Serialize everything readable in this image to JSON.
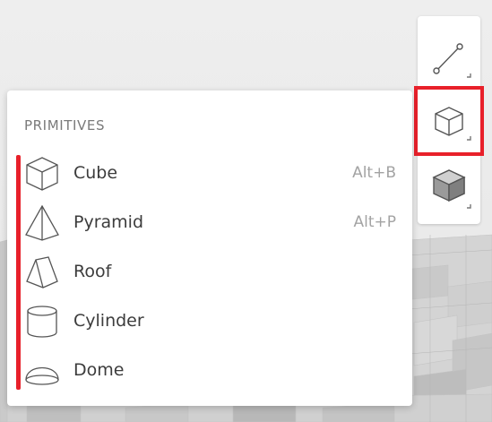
{
  "panel": {
    "title": "PRIMITIVES",
    "items": [
      {
        "label": "Cube",
        "shortcut": "Alt+B",
        "icon": "cube-icon"
      },
      {
        "label": "Pyramid",
        "shortcut": "Alt+P",
        "icon": "pyramid-icon"
      },
      {
        "label": "Roof",
        "shortcut": "",
        "icon": "roof-icon"
      },
      {
        "label": "Cylinder",
        "shortcut": "",
        "icon": "cylinder-icon"
      },
      {
        "label": "Dome",
        "shortcut": "",
        "icon": "dome-icon"
      }
    ]
  },
  "toolbar": {
    "tools": [
      {
        "icon": "line-tool-icon",
        "selected": false
      },
      {
        "icon": "primitive-cube-icon",
        "selected": true
      },
      {
        "icon": "solid-box-icon",
        "selected": false
      }
    ]
  },
  "colors": {
    "accent": "#e8202a",
    "panel_bg": "#ffffff",
    "text": "#3c3c3c",
    "muted_text": "#a3a3a3"
  }
}
